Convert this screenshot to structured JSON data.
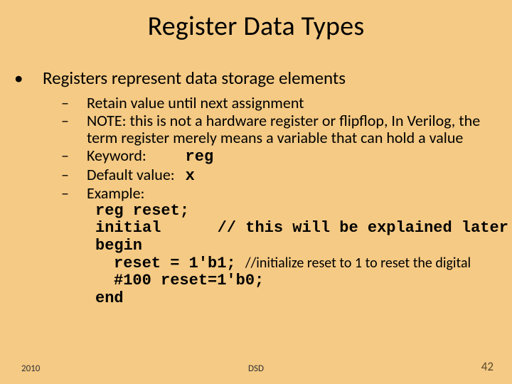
{
  "title": "Register Data Types",
  "bullet1": "Registers represent data storage elements",
  "sub1": "Retain value until next assignment",
  "sub2": "NOTE: this is not a hardware register or flipflop, In Verilog, the term register merely means a variable that can hold a value",
  "sub3_label": "Keyword:",
  "sub3_code": "reg",
  "sub4_label": "Default value:",
  "sub4_code": "x",
  "sub5_label": "Example:",
  "code1": "reg reset;",
  "code2a": "initial",
  "code2b": "// this will be explained later",
  "code3": "begin",
  "code4a": "reset = 1'b1;",
  "code4b": "//initialize reset to 1 to reset the digital",
  "code5": "#100 reset=1'b0;",
  "code6": "end",
  "footer_year": "2010",
  "footer_center": "DSD",
  "footer_page": "42"
}
